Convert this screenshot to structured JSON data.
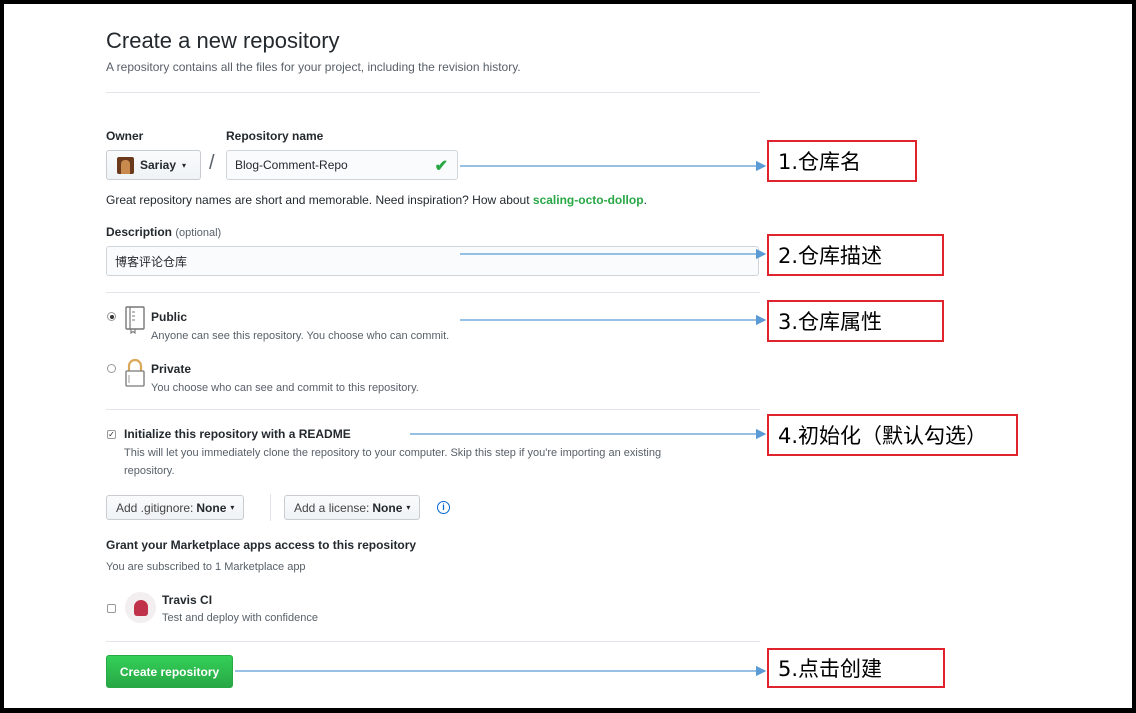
{
  "header": {
    "title": "Create a new repository",
    "subtitle": "A repository contains all the files for your project, including the revision history."
  },
  "owner": {
    "label": "Owner",
    "value": "Sariay",
    "caret": "▾"
  },
  "repo_name": {
    "label": "Repository name",
    "separator": "/",
    "value": "Blog-Comment-Repo",
    "valid_icon": "check-icon"
  },
  "hint": {
    "text": "Great repository names are short and memorable. Need inspiration? How about ",
    "suggestion": "scaling-octo-dollop",
    "suffix": "."
  },
  "description": {
    "label": "Description",
    "optional": "(optional)",
    "value": "博客评论仓库"
  },
  "visibility": {
    "public": {
      "label": "Public",
      "desc": "Anyone can see this repository. You choose who can commit.",
      "selected": true,
      "icon": "book-icon"
    },
    "private": {
      "label": "Private",
      "desc": "You choose who can see and commit to this repository.",
      "selected": false,
      "icon": "lock-icon"
    }
  },
  "init": {
    "label": "Initialize this repository with a README",
    "desc_line1": "This will let you immediately clone the repository to your computer. Skip this step if you're importing an existing",
    "desc_line2": "repository.",
    "checked": true
  },
  "gitignore": {
    "prefix": "Add .gitignore:",
    "value": "None",
    "caret": "▾"
  },
  "license": {
    "prefix": "Add a license:",
    "value": "None",
    "caret": "▾",
    "info_icon": "info-icon"
  },
  "marketplace": {
    "title": "Grant your Marketplace apps access to this repository",
    "subtitle": "You are subscribed to 1 Marketplace app",
    "app_name": "Travis CI",
    "app_desc": "Test and deploy with confidence",
    "checked": false
  },
  "submit": {
    "label": "Create repository"
  },
  "annotations": [
    "1.仓库名",
    "2.仓库描述",
    "3.仓库属性",
    "4.初始化（默认勾选）",
    "5.点击创建"
  ],
  "colors": {
    "primary_green": "#28a745",
    "annotation_border": "#e0242d",
    "arrow_blue": "#5b9bd5",
    "link_blue": "#0366d6"
  }
}
